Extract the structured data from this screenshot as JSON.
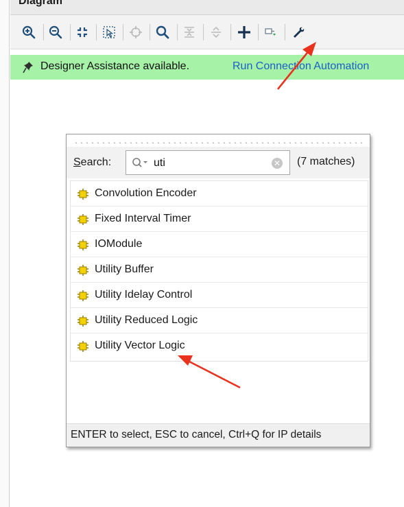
{
  "panel": {
    "title": "Diagram"
  },
  "toolbar": {
    "buttons": [
      {
        "icon": "zoom-in-icon"
      },
      {
        "icon": "zoom-out-icon"
      },
      {
        "icon": "zoom-fit-icon"
      },
      {
        "icon": "zoom-area-icon"
      },
      {
        "icon": "auto-connect-icon"
      },
      {
        "icon": "search-icon"
      },
      {
        "icon": "collapse-all-icon"
      },
      {
        "icon": "expand-all-icon"
      },
      {
        "icon": "add-ip-icon"
      },
      {
        "icon": "add-module-icon"
      },
      {
        "icon": "settings-wrench-icon"
      }
    ]
  },
  "assistance": {
    "message": "Designer Assistance available.",
    "link": "Run Connection Automation"
  },
  "ip_search": {
    "label": "Search:",
    "query": "uti",
    "matches": "(7 matches)",
    "results": [
      "Convolution Encoder",
      "Fixed Interval Timer",
      "IOModule",
      "Utility Buffer",
      "Utility Idelay Control",
      "Utility Reduced Logic",
      "Utility Vector Logic"
    ],
    "hint": "ENTER to select, ESC to cancel, Ctrl+Q for IP details"
  },
  "colors": {
    "assist_bg": "#a6f3a8",
    "link": "#1a5fc7",
    "arrow": "#e8321e",
    "ip_icon": "#d1ad00"
  }
}
